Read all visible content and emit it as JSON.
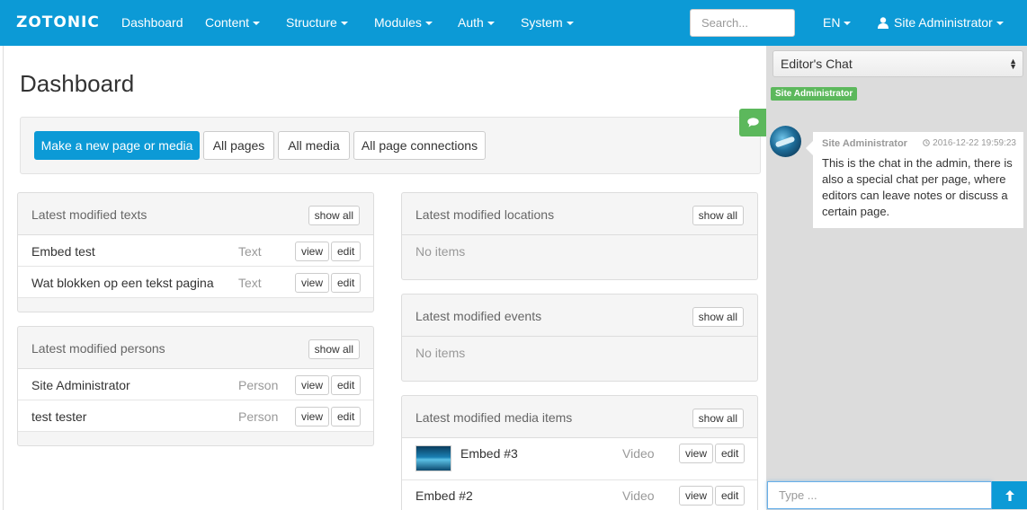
{
  "navbar": {
    "logo": "ZOTONIC",
    "items": [
      {
        "label": "Dashboard"
      },
      {
        "label": "Content"
      },
      {
        "label": "Structure"
      },
      {
        "label": "Modules"
      },
      {
        "label": "Auth"
      },
      {
        "label": "System"
      }
    ],
    "search_placeholder": "Search...",
    "language": "EN",
    "user": "Site Administrator"
  },
  "main": {
    "title": "Dashboard",
    "actions": {
      "new": "Make a new page or media",
      "all_pages": "All pages",
      "all_media": "All media",
      "all_connections": "All page connections"
    },
    "panels": {
      "texts": {
        "title": "Latest modified texts",
        "show_all": "show all",
        "rows": [
          {
            "title": "Embed test",
            "type": "Text",
            "view": "view",
            "edit": "edit"
          },
          {
            "title": "Wat blokken op een tekst pagina",
            "type": "Text",
            "view": "view",
            "edit": "edit"
          }
        ]
      },
      "persons": {
        "title": "Latest modified persons",
        "show_all": "show all",
        "rows": [
          {
            "title": "Site Administrator",
            "type": "Person",
            "view": "view",
            "edit": "edit"
          },
          {
            "title": "test tester",
            "type": "Person",
            "view": "view",
            "edit": "edit"
          }
        ]
      },
      "locations": {
        "title": "Latest modified locations",
        "show_all": "show all",
        "empty": "No items"
      },
      "events": {
        "title": "Latest modified events",
        "show_all": "show all",
        "empty": "No items"
      },
      "media": {
        "title": "Latest modified media items",
        "show_all": "show all",
        "rows": [
          {
            "title": "Embed #3",
            "type": "Video",
            "view": "view",
            "edit": "edit"
          },
          {
            "title": "Embed #2",
            "type": "Video",
            "view": "view",
            "edit": "edit"
          }
        ]
      }
    }
  },
  "sidebar": {
    "chat_select": "Editor's Chat",
    "user_label": "Site Administrator",
    "message": {
      "author": "Site Administrator",
      "time": "2016-12-22 19:59:23",
      "text": "This is the chat in the admin, there is also a special chat per page, where editors can leave notes or discuss a certain page."
    },
    "input_placeholder": "Type ..."
  },
  "colors": {
    "brand": "#0c9ad6",
    "success": "#5cb85c",
    "sidebar_bg": "#dcdcdc"
  }
}
